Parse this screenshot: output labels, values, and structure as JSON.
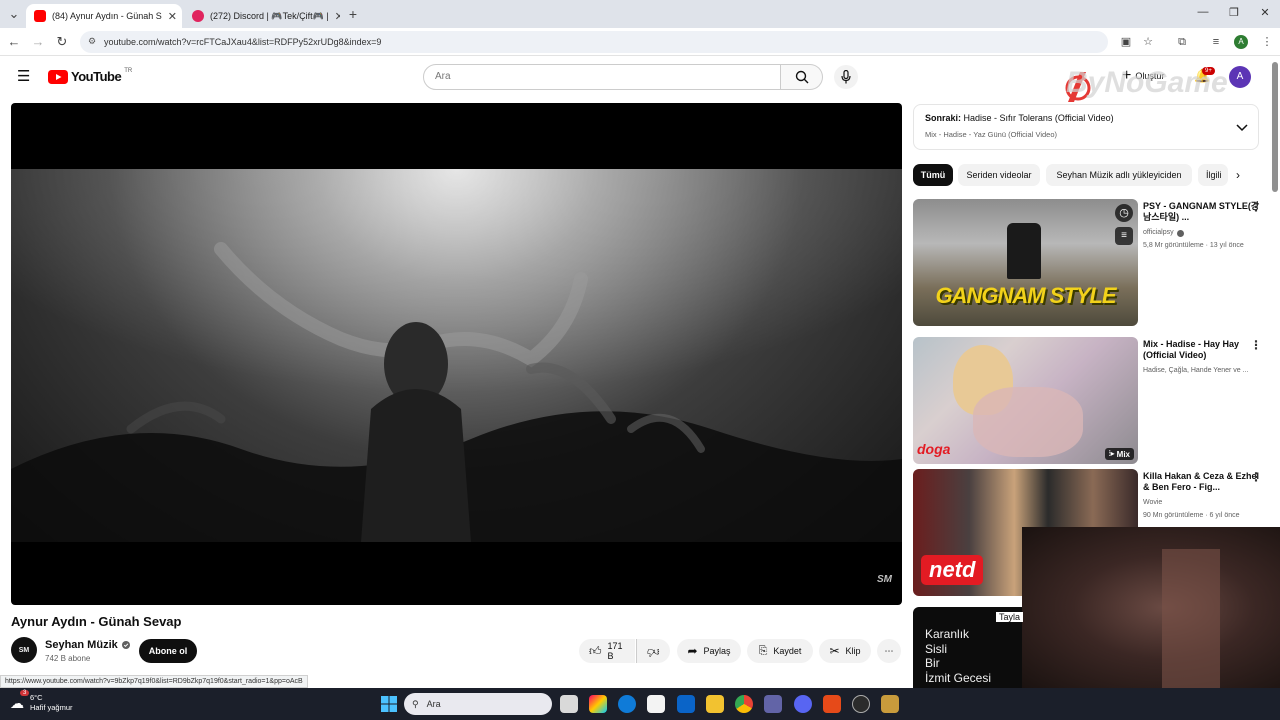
{
  "browser": {
    "tabs": [
      {
        "label": "(84) Aynur Aydın - Günah S",
        "active": true
      },
      {
        "label": "(272) Discord | 🎮Tek/Çift🎮 | ",
        "active": false
      }
    ],
    "new_tab": "+",
    "url": "youtube.com/watch?v=rcFTCaJXau4&list=RDFPy52xrUDg8&index=9",
    "status_url": "https://www.youtube.com/watch?v=9bZkp7q19f0&list=RD9bZkp7q19f0&start_radio=1&pp=oAcB"
  },
  "youtube": {
    "logo_text": "YouTube",
    "region": "TR",
    "search_placeholder": "Ara",
    "create_label": "Oluştur",
    "notif_badge": "9+",
    "avatar_letter": "A"
  },
  "watermark": {
    "text": "ByNoGame"
  },
  "player": {
    "logo": "SM"
  },
  "video": {
    "title": "Aynur Aydın - Günah Sevap",
    "channel": "Seyhan Müzik",
    "channel_avatar": "SM",
    "subscribers": "742 B abone",
    "subscribe_label": "Abone ol",
    "likes": "171 B",
    "share_label": "Paylaş",
    "save_label": "Kaydet",
    "clip_label": "Klip",
    "more": "⋯"
  },
  "sidebar": {
    "next_prefix": "Sonraki:",
    "next_title": "Hadise - Sıfır Tolerans (Official Video)",
    "next_mix": "Mix - Hadise - Yaz Günü (Official Video)",
    "chips": [
      "Tümü",
      "Seriden videolar",
      "Seyhan Müzik adlı yükleyiciden",
      "İlgili"
    ],
    "videos": [
      {
        "title": "PSY - GANGNAM STYLE(강남스타일) ...",
        "channel": "officialpsy",
        "meta": "5,8 Mr görüntüleme · 13 yıl önce",
        "thumb_text": "GANGNAM STYLE"
      },
      {
        "title": "Mix - Hadise - Hay Hay (Official Video)",
        "channel": "Hadise, Çağla, Hande Yener ve ...",
        "meta": "",
        "badge": "Mix",
        "thumb_text": "doga"
      },
      {
        "title": "Killa Hakan & Ceza & Ezhel & Ben Fero - Fig...",
        "channel": "Wovie",
        "meta": "90 Mn görüntüleme · 6 yıl önce",
        "thumb_text": "netd"
      },
      {
        "title": "Tayla",
        "channel": "",
        "meta": "",
        "thumb_lines": [
          "Karanlık",
          "Sisli",
          "Bir",
          "İzmit Gecesi"
        ]
      }
    ]
  },
  "taskbar": {
    "temp": "6°C",
    "weather": "Hafif yağmur",
    "weather_badge": "3",
    "search": "Ara"
  }
}
